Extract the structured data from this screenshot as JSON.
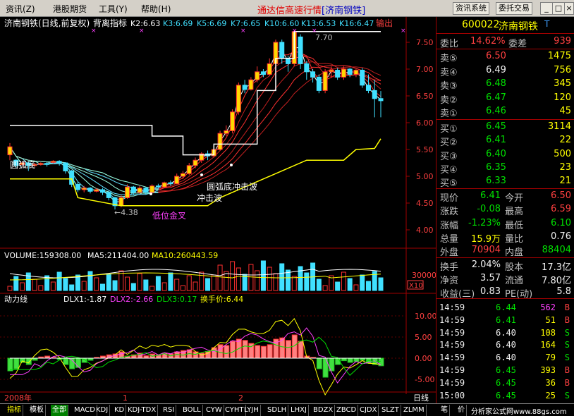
{
  "menu": {
    "items": [
      "资讯(Z)",
      "港股期货",
      "工具(Y)",
      "帮助(H)"
    ],
    "title_prefix": "通达信高速行情",
    "title_stock": "[济南钢铁]",
    "btn_info": "资讯系统",
    "btn_trade": "委托交易",
    "min": "_",
    "max": "□",
    "close": "×"
  },
  "kline": {
    "header_name": "济南钢铁(日线,前复权)",
    "indicator": "背离指标",
    "k_vals": [
      {
        "text": "K2:6.63",
        "color": "#ffffff"
      },
      {
        "text": "K3:6.69",
        "color": "#40e0ff"
      },
      {
        "text": "K5:6.69",
        "color": "#40e0ff"
      },
      {
        "text": "K7:6.65",
        "color": "#40e0ff"
      },
      {
        "text": "K10:6.60",
        "color": "#40e0ff"
      },
      {
        "text": "K13:6.53",
        "color": "#40e0ff"
      },
      {
        "text": "K16:6.47",
        "color": "#40e0ff"
      }
    ],
    "output_label": "输出",
    "price_axis": [
      "7.50",
      "7.00",
      "6.50",
      "6.00",
      "5.50",
      "5.00",
      "4.50",
      "4.00"
    ],
    "annotations": {
      "arc_bottom": "圆弧底",
      "arc_bottom_wave": "圆弧底冲击波",
      "impact_wave": "冲击波",
      "low_gold_cross": "低位金叉",
      "low_price": "←4.38",
      "high_price": "7.70"
    },
    "candles": [
      {
        "o": 5.4,
        "c": 5.55,
        "h": 5.62,
        "l": 5.3
      },
      {
        "o": 5.3,
        "c": 5.2,
        "h": 5.32,
        "l": 5.15
      },
      {
        "o": 5.22,
        "c": 5.25,
        "h": 5.28,
        "l": 5.18
      },
      {
        "o": 5.25,
        "c": 5.2,
        "h": 5.28,
        "l": 5.1
      },
      {
        "o": 5.2,
        "c": 5.22,
        "h": 5.25,
        "l": 5.18
      },
      {
        "o": 5.22,
        "c": 5.24,
        "h": 5.26,
        "l": 5.2
      },
      {
        "o": 5.24,
        "c": 5.22,
        "h": 5.26,
        "l": 5.18
      },
      {
        "o": 5.26,
        "c": 5.28,
        "h": 5.3,
        "l": 5.24
      },
      {
        "o": 5.28,
        "c": 5.25,
        "h": 5.3,
        "l": 5.2
      },
      {
        "o": 5.25,
        "c": 5.1,
        "h": 5.26,
        "l": 5.05
      },
      {
        "o": 5.1,
        "c": 4.85,
        "h": 5.12,
        "l": 4.8
      },
      {
        "o": 4.85,
        "c": 4.75,
        "h": 4.9,
        "l": 4.7
      },
      {
        "o": 4.75,
        "c": 4.78,
        "h": 4.82,
        "l": 4.7
      },
      {
        "o": 4.78,
        "c": 4.72,
        "h": 4.8,
        "l": 4.68
      },
      {
        "o": 4.72,
        "c": 4.75,
        "h": 4.78,
        "l": 4.7
      },
      {
        "o": 4.75,
        "c": 4.7,
        "h": 4.78,
        "l": 4.65
      },
      {
        "o": 4.7,
        "c": 4.6,
        "h": 4.72,
        "l": 4.55
      },
      {
        "o": 4.6,
        "c": 4.45,
        "h": 4.62,
        "l": 4.38
      },
      {
        "o": 4.45,
        "c": 4.6,
        "h": 4.65,
        "l": 4.42
      },
      {
        "o": 4.6,
        "c": 4.8,
        "h": 4.85,
        "l": 4.58
      },
      {
        "o": 4.8,
        "c": 4.7,
        "h": 4.82,
        "l": 4.65
      },
      {
        "o": 4.7,
        "c": 4.78,
        "h": 4.82,
        "l": 4.68
      },
      {
        "o": 4.78,
        "c": 4.7,
        "h": 4.8,
        "l": 4.66
      },
      {
        "o": 4.7,
        "c": 4.82,
        "h": 4.85,
        "l": 4.68
      },
      {
        "o": 4.82,
        "c": 4.8,
        "h": 4.86,
        "l": 4.75
      },
      {
        "o": 4.8,
        "c": 4.88,
        "h": 4.9,
        "l": 4.78
      },
      {
        "o": 4.88,
        "c": 4.86,
        "h": 4.92,
        "l": 4.82
      },
      {
        "o": 4.86,
        "c": 5.0,
        "h": 5.05,
        "l": 4.85
      },
      {
        "o": 5.0,
        "c": 5.05,
        "h": 5.1,
        "l": 4.95
      },
      {
        "o": 5.05,
        "c": 5.2,
        "h": 5.25,
        "l": 5.02
      },
      {
        "o": 5.2,
        "c": 5.3,
        "h": 5.35,
        "l": 5.15
      },
      {
        "o": 5.3,
        "c": 5.42,
        "h": 5.45,
        "l": 5.25
      },
      {
        "o": 5.42,
        "c": 5.38,
        "h": 5.48,
        "l": 5.3
      },
      {
        "o": 5.38,
        "c": 5.5,
        "h": 5.55,
        "l": 5.35
      },
      {
        "o": 5.5,
        "c": 5.8,
        "h": 5.85,
        "l": 5.48
      },
      {
        "o": 5.8,
        "c": 5.85,
        "h": 5.95,
        "l": 5.75
      },
      {
        "o": 5.85,
        "c": 6.2,
        "h": 6.25,
        "l": 5.8
      },
      {
        "o": 6.2,
        "c": 6.7,
        "h": 6.75,
        "l": 6.15
      },
      {
        "o": 6.7,
        "c": 6.62,
        "h": 6.8,
        "l": 6.55
      },
      {
        "o": 6.62,
        "c": 6.8,
        "h": 6.85,
        "l": 6.6
      },
      {
        "o": 6.8,
        "c": 6.95,
        "h": 7.05,
        "l": 6.75
      },
      {
        "o": 6.95,
        "c": 6.9,
        "h": 7.0,
        "l": 6.85
      },
      {
        "o": 6.9,
        "c": 7.1,
        "h": 7.2,
        "l": 6.88
      },
      {
        "o": 7.1,
        "c": 7.5,
        "h": 7.55,
        "l": 7.05
      },
      {
        "o": 7.5,
        "c": 7.2,
        "h": 7.55,
        "l": 7.1
      },
      {
        "o": 7.2,
        "c": 7.1,
        "h": 7.25,
        "l": 6.95
      },
      {
        "o": 7.1,
        "c": 7.7,
        "h": 7.7,
        "l": 7.05
      },
      {
        "o": 7.6,
        "c": 7.1,
        "h": 7.65,
        "l": 7.0
      },
      {
        "o": 7.1,
        "c": 6.95,
        "h": 7.15,
        "l": 6.8
      },
      {
        "o": 6.95,
        "c": 6.85,
        "h": 7.0,
        "l": 6.75
      },
      {
        "o": 6.85,
        "c": 6.6,
        "h": 6.9,
        "l": 6.55
      },
      {
        "o": 6.6,
        "c": 6.95,
        "h": 7.0,
        "l": 6.55
      },
      {
        "o": 6.95,
        "c": 6.98,
        "h": 7.05,
        "l": 6.85
      },
      {
        "o": 6.98,
        "c": 6.85,
        "h": 7.02,
        "l": 6.8
      },
      {
        "o": 6.85,
        "c": 7.0,
        "h": 7.05,
        "l": 6.8
      },
      {
        "o": 7.0,
        "c": 6.9,
        "h": 7.02,
        "l": 6.85
      },
      {
        "o": 6.9,
        "c": 6.98,
        "h": 7.0,
        "l": 6.85
      },
      {
        "o": 6.98,
        "c": 6.7,
        "h": 7.02,
        "l": 6.65
      },
      {
        "o": 6.7,
        "c": 6.6,
        "h": 6.9,
        "l": 6.55
      },
      {
        "o": 6.6,
        "c": 6.45,
        "h": 6.8,
        "l": 6.1
      },
      {
        "o": 6.45,
        "c": 6.41,
        "h": 6.59,
        "l": 6.1
      }
    ]
  },
  "volume": {
    "header": "VOLUME:159308.00",
    "ma5": "MA5:211404.00",
    "ma10": "MA10:260443.59",
    "axis_label": "30000",
    "unit": "X10"
  },
  "dlx": {
    "name": "动力线",
    "dlx1": "DLX1:-1.87",
    "dlx2": "DLX2:-2.66",
    "dlx3": "DLX3:0.17",
    "turnover_price": "换手价:6.44",
    "axis": [
      "10.00",
      "5.00",
      "0.00",
      "-5.00"
    ]
  },
  "x_axis": {
    "year": "2008年",
    "m1": "1",
    "m2": "2",
    "period": "日线"
  },
  "quote": {
    "code": "600022",
    "name": "济南钢铁",
    "flag": "T",
    "weibi_label": "委比",
    "weibi": "14.62%",
    "weicha_label": "委差",
    "weicha": "939",
    "asks": [
      {
        "label": "卖⑤",
        "price": "6.50",
        "vol": "1475",
        "color": "red"
      },
      {
        "label": "卖④",
        "price": "6.49",
        "vol": "756",
        "color": "white"
      },
      {
        "label": "卖③",
        "price": "6.48",
        "vol": "345",
        "color": "green"
      },
      {
        "label": "卖②",
        "price": "6.47",
        "vol": "120",
        "color": "green"
      },
      {
        "label": "卖①",
        "price": "6.46",
        "vol": "45",
        "color": "green"
      }
    ],
    "bids": [
      {
        "label": "买①",
        "price": "6.45",
        "vol": "3114",
        "color": "green"
      },
      {
        "label": "买②",
        "price": "6.41",
        "vol": "22",
        "color": "green"
      },
      {
        "label": "买③",
        "price": "6.40",
        "vol": "500",
        "color": "green"
      },
      {
        "label": "买④",
        "price": "6.35",
        "vol": "23",
        "color": "green"
      },
      {
        "label": "买⑤",
        "price": "6.33",
        "vol": "21",
        "color": "green"
      }
    ],
    "stats": [
      {
        "l1": "现价",
        "v1": "6.41",
        "c1": "green",
        "l2": "今开",
        "v2": "6.50",
        "c2": "red"
      },
      {
        "l1": "涨跌",
        "v1": "-0.08",
        "c1": "green",
        "l2": "最高",
        "v2": "6.59",
        "c2": "red"
      },
      {
        "l1": "涨幅",
        "v1": "-1.23%",
        "c1": "green",
        "l2": "最低",
        "v2": "6.10",
        "c2": "green"
      },
      {
        "l1": "总量",
        "v1": "15.9万",
        "c1": "yellow",
        "l2": "量比",
        "v2": "0.76",
        "c2": "white"
      },
      {
        "l1": "外盘",
        "v1": "70904",
        "c1": "red",
        "l2": "内盘",
        "v2": "88404",
        "c2": "green"
      }
    ],
    "stats2": [
      {
        "l1": "换手",
        "v1": "2.04%",
        "c1": "white",
        "l2": "股本",
        "v2": "17.3亿",
        "c2": "white"
      },
      {
        "l1": "净资",
        "v1": "3.57",
        "c1": "white",
        "l2": "流通",
        "v2": "7.80亿",
        "c2": "white"
      },
      {
        "l1": "收益(三)",
        "v1": "0.83",
        "c1": "white",
        "l2": "PE(动)",
        "v2": "5.8",
        "c2": "white"
      }
    ],
    "ticks": [
      {
        "time": "14:59",
        "price": "6.44",
        "vol": "562",
        "side": "B",
        "vcolor": "magenta",
        "scolor": "red"
      },
      {
        "time": "14:59",
        "price": "6.41",
        "vol": "51",
        "side": "B",
        "vcolor": "yellow",
        "scolor": "red"
      },
      {
        "time": "14:59",
        "price": "6.40",
        "vol": "108",
        "side": "S",
        "vcolor": "yellow",
        "scolor": "green"
      },
      {
        "time": "14:59",
        "price": "6.40",
        "vol": "164",
        "side": "S",
        "vcolor": "yellow",
        "scolor": "green"
      },
      {
        "time": "14:59",
        "price": "6.40",
        "vol": "79",
        "side": "S",
        "vcolor": "yellow",
        "scolor": "green"
      },
      {
        "time": "14:59",
        "price": "6.45",
        "vol": "393",
        "side": "B",
        "vcolor": "yellow",
        "scolor": "red"
      },
      {
        "time": "14:59",
        "price": "6.45",
        "vol": "36",
        "side": "B",
        "vcolor": "yellow",
        "scolor": "red"
      },
      {
        "time": "15:00",
        "price": "6.45",
        "vol": "25",
        "side": "S",
        "vcolor": "yellow",
        "scolor": "green"
      }
    ]
  },
  "tabs": [
    "指标",
    "模板",
    "全部",
    "MACD",
    "KDJ",
    "KD",
    "KDJ-TDX",
    "RSI",
    "BOLL",
    "CYW",
    "CYHT",
    "LYJH",
    "SDLH",
    "LHXJ",
    "BDZX",
    "ZBCD",
    "CJDX",
    "SLZT",
    "ZLMM",
    "笔",
    "价"
  ],
  "footer_note": "分析家公式网www.88gs.com",
  "colors": {
    "up": "#ff3030",
    "down": "#40e0ff",
    "border": "#a00000"
  }
}
